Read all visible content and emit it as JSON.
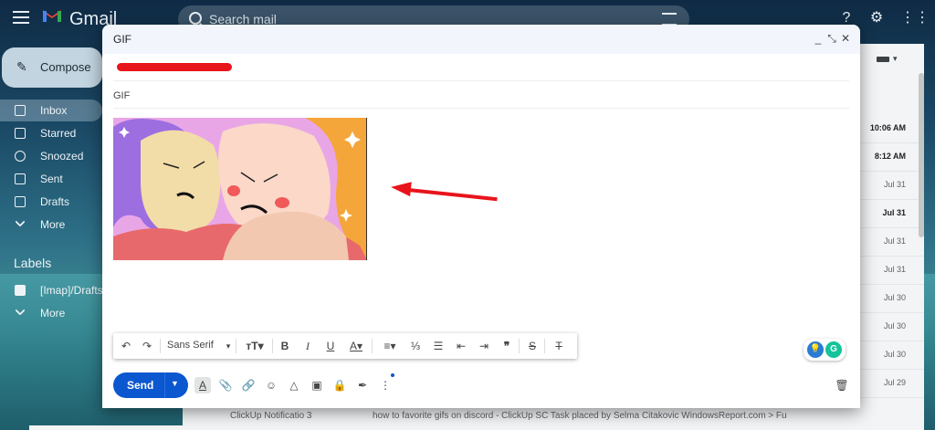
{
  "app": {
    "logo_text": "Gmail"
  },
  "search": {
    "placeholder": "Search mail"
  },
  "compose_button": {
    "label": "Compose"
  },
  "sidebar": {
    "items": [
      {
        "label": "Inbox",
        "active": true
      },
      {
        "label": "Starred"
      },
      {
        "label": "Snoozed"
      },
      {
        "label": "Sent"
      },
      {
        "label": "Drafts"
      },
      {
        "label": "More"
      }
    ],
    "labels_heading": "Labels",
    "label_items": [
      {
        "label": "[Imap]/Drafts"
      },
      {
        "label": "More"
      }
    ]
  },
  "mail_list": {
    "dates": [
      "10:06 AM",
      "8:12 AM",
      "Jul 31",
      "Jul 31",
      "Jul 31",
      "Jul 31",
      "Jul 30",
      "Jul 30",
      "Jul 30",
      "Jul 29"
    ],
    "bottom_row": {
      "sender": "ClickUp Notificatio",
      "count": "3",
      "subject": "how to favorite gifs on discord - ClickUp SC Task placed by Selma Citakovic WindowsReport.com > Fu"
    }
  },
  "compose_dialog": {
    "title": "GIF",
    "subject": "GIF",
    "controls": {
      "minimize": "_",
      "fullscreen": "⤡",
      "close": "✕"
    },
    "font_family": "Sans Serif",
    "send_label": "Send"
  },
  "colors": {
    "accent": "#0b57d0",
    "annotation_red": "#e8141c"
  }
}
